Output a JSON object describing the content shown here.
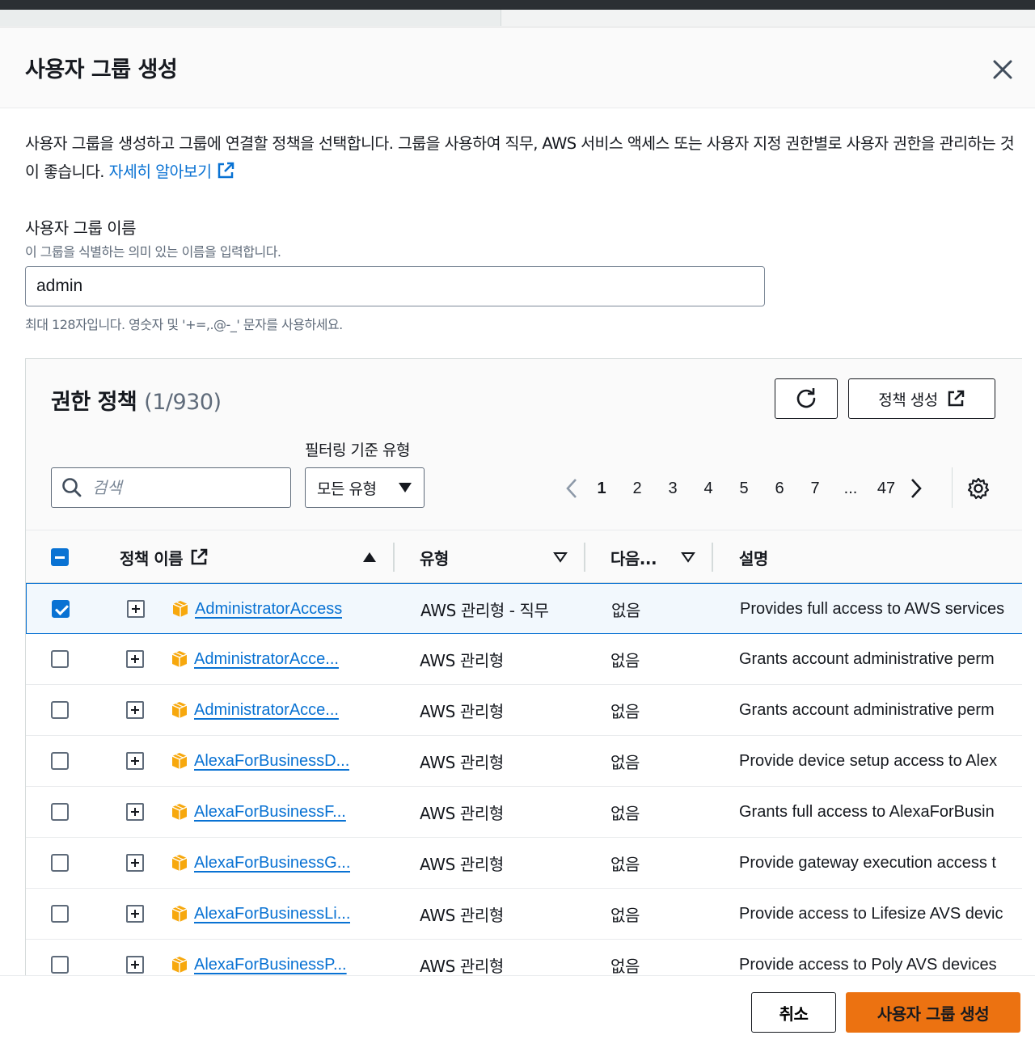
{
  "modal": {
    "title": "사용자 그룹 생성",
    "description": "사용자 그룹을 생성하고 그룹에 연결할 정책을 선택합니다. 그룹을 사용하여 직무, AWS 서비스 액세스 또는 사용자 지정 권한별로 사용자 권한을 관리하는 것이 좋습니다. ",
    "learn_more": "자세히 알아보기"
  },
  "group_name": {
    "label": "사용자 그룹 이름",
    "hint": "이 그룹을 식별하는 의미 있는 이름을 입력합니다.",
    "value": "admin",
    "constraint": "최대 128자입니다. 영숫자 및 '+=,.@-_' 문자를 사용하세요."
  },
  "policies": {
    "title": "권한 정책",
    "count": "(1/930)",
    "create_button": "정책 생성",
    "filter_label": "필터링 기준 유형",
    "search_placeholder": "검색",
    "type_select": "모든 유형",
    "pages": [
      "1",
      "2",
      "3",
      "4",
      "5",
      "6",
      "7",
      "...",
      "47"
    ],
    "current_page": "1",
    "columns": {
      "name": "정책 이름",
      "type": "유형",
      "next": "다음...",
      "description": "설명"
    },
    "rows": [
      {
        "name": "AdministratorAccess",
        "type": "AWS 관리형 - 직무",
        "next": "없음",
        "description": "Provides full access to AWS services",
        "checked": true
      },
      {
        "name": "AdministratorAcce...",
        "type": "AWS 관리형",
        "next": "없음",
        "description": "Grants account administrative perm",
        "checked": false
      },
      {
        "name": "AdministratorAcce...",
        "type": "AWS 관리형",
        "next": "없음",
        "description": "Grants account administrative perm",
        "checked": false
      },
      {
        "name": "AlexaForBusinessD...",
        "type": "AWS 관리형",
        "next": "없음",
        "description": "Provide device setup access to Alex",
        "checked": false
      },
      {
        "name": "AlexaForBusinessF...",
        "type": "AWS 관리형",
        "next": "없음",
        "description": "Grants full access to AlexaForBusin",
        "checked": false
      },
      {
        "name": "AlexaForBusinessG...",
        "type": "AWS 관리형",
        "next": "없음",
        "description": "Provide gateway execution access t",
        "checked": false
      },
      {
        "name": "AlexaForBusinessLi...",
        "type": "AWS 관리형",
        "next": "없음",
        "description": "Provide access to Lifesize AVS devic",
        "checked": false
      },
      {
        "name": "AlexaForBusinessP...",
        "type": "AWS 관리형",
        "next": "없음",
        "description": "Provide access to Poly AVS devices",
        "checked": false
      }
    ]
  },
  "footer": {
    "cancel": "취소",
    "submit": "사용자 그룹 생성"
  },
  "colors": {
    "accent": "#0972d3",
    "primary_button": "#ec7211",
    "text": "#16191f",
    "muted": "#5f6b7a"
  }
}
